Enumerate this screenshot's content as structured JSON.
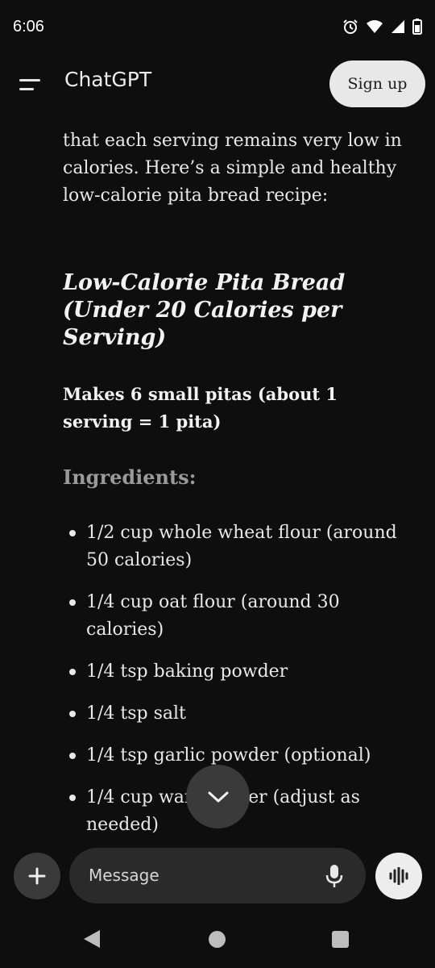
{
  "status_bar": {
    "time": "6:06",
    "icons": [
      "alarm-icon",
      "wifi-icon",
      "signal-icon",
      "battery-icon"
    ]
  },
  "app_bar": {
    "title": "ChatGPT",
    "signup_label": "Sign up",
    "menu_icon": "menu-icon"
  },
  "message": {
    "intro": "that each serving remains very low in calories. Here’s a simple and healthy low-calorie pita bread recipe:",
    "recipe_title": "Low-Calorie Pita Bread (Under 20 Calories per Serving)",
    "makes": "Makes 6 small pitas (about 1 serving = 1 pita)",
    "ingredients_heading": "Ingredients:",
    "ingredients": [
      "1/2 cup whole wheat flour (around 50 calories)",
      "1/4 cup oat flour (around 30 calories)",
      "1/4 tsp baking powder",
      "1/4 tsp salt",
      "1/4 tsp garlic powder (optional)",
      "1/4 cup warm water (adjust as needed)"
    ]
  },
  "composer": {
    "placeholder": "Message",
    "plus_icon": "plus-icon",
    "mic_icon": "mic-icon",
    "voice_icon": "voice-waveform-icon"
  },
  "scroll_button_icon": "chevron-down-icon",
  "nav_bar": [
    "back-icon",
    "home-icon",
    "recents-icon"
  ],
  "colors": {
    "background": "#0e0e0e",
    "signup_bg": "#e8e8e8",
    "composer_bg": "#2a2a2a",
    "muted_heading": "#9a9a9a"
  }
}
